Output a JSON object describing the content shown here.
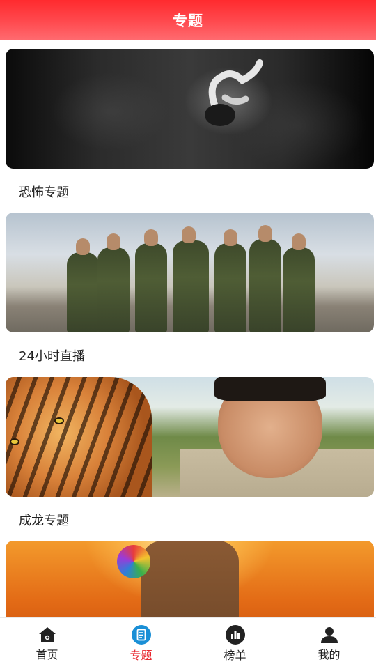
{
  "header": {
    "title": "专题"
  },
  "topics": [
    {
      "title": "恐怖专题"
    },
    {
      "title": "24小时直播"
    },
    {
      "title": "成龙专题"
    },
    {
      "title": ""
    }
  ],
  "tabbar": {
    "active": "专题",
    "items": [
      {
        "label": "首页",
        "icon": "home-icon"
      },
      {
        "label": "专题",
        "icon": "topic-icon"
      },
      {
        "label": "榜单",
        "icon": "ranking-icon"
      },
      {
        "label": "我的",
        "icon": "profile-icon"
      }
    ]
  },
  "colors": {
    "header_top": "#ff2a2e",
    "header_bottom": "#ff6a6f",
    "accent": "#e8262e",
    "topic_icon_bg": "#1a8fd6"
  }
}
